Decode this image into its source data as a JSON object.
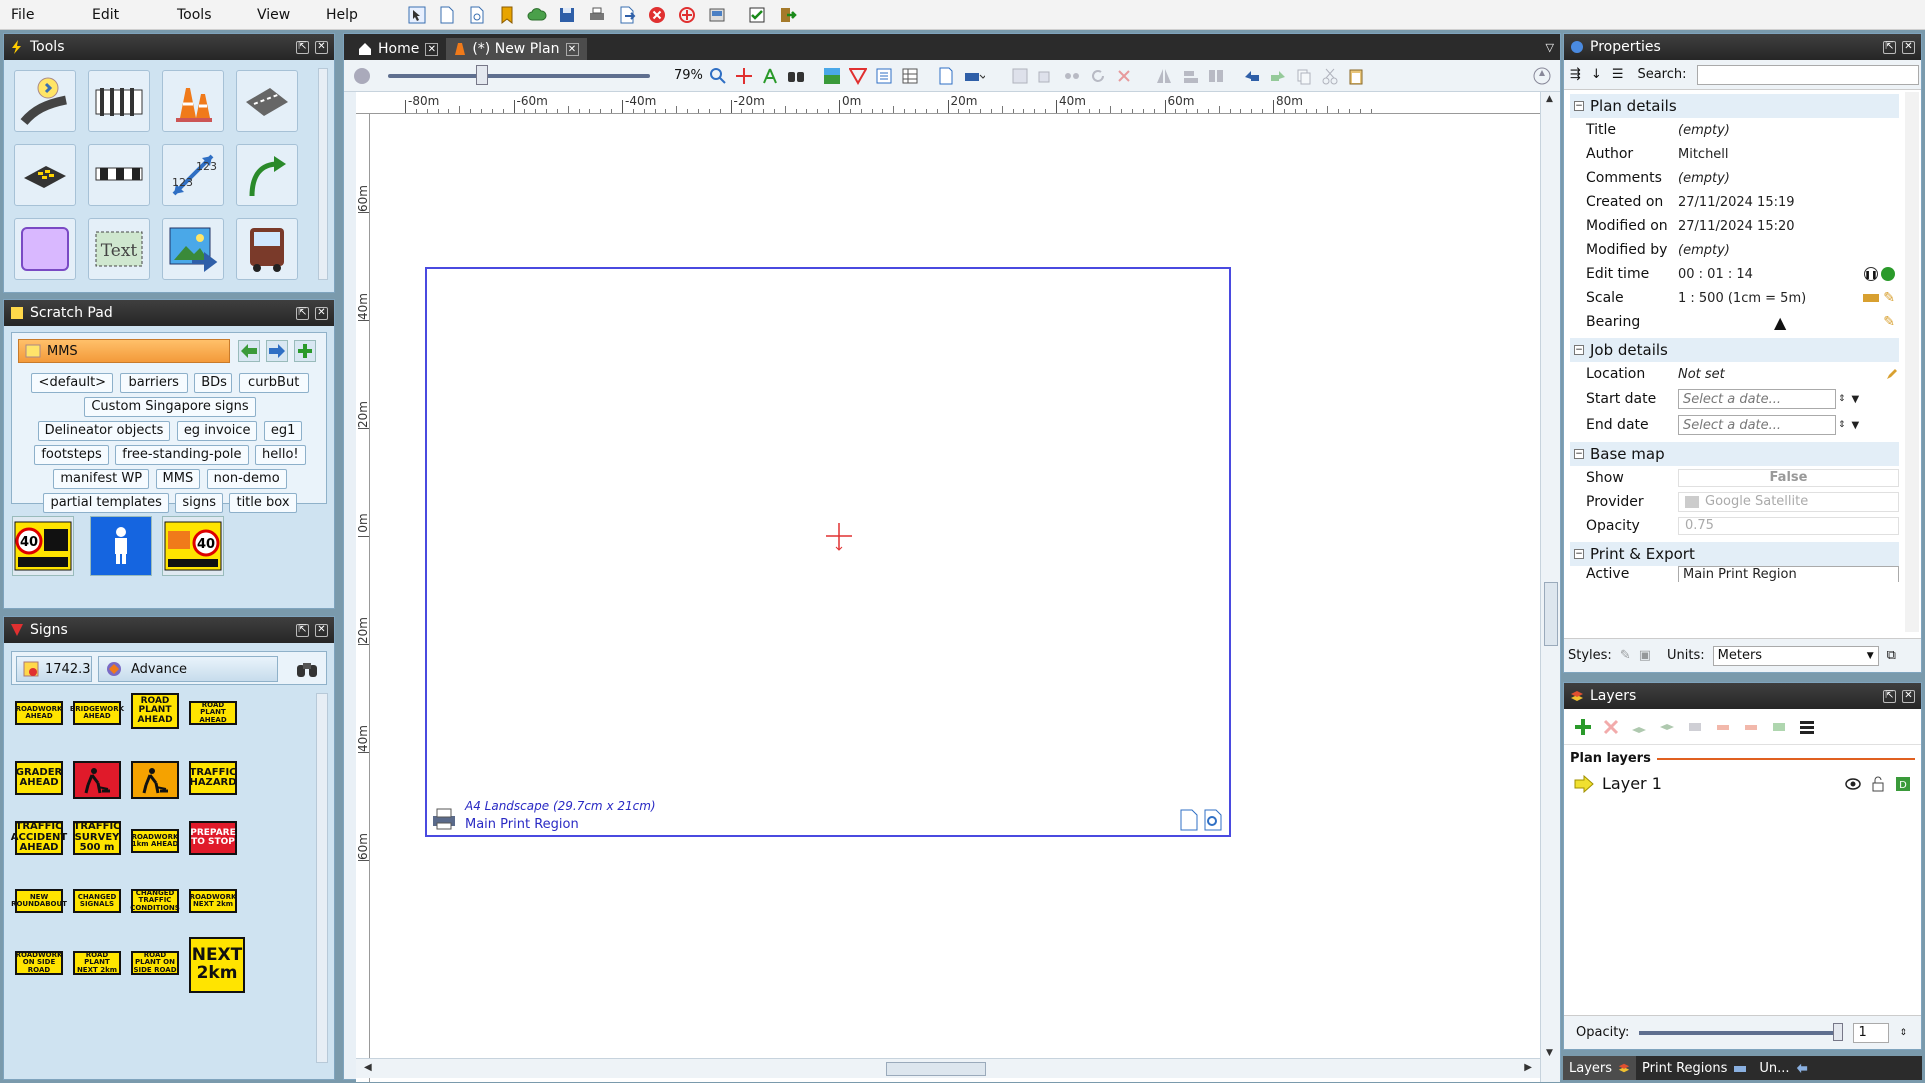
{
  "menu": [
    "File",
    "Edit",
    "Tools",
    "View",
    "Help"
  ],
  "toolbar_icons": [
    "select-icon",
    "new-icon",
    "open-icon",
    "tag-icon",
    "cloud-icon",
    "save-icon",
    "print-icon",
    "export-icon",
    "close-red-icon",
    "target-icon",
    "scanner-icon",
    "check-icon",
    "exit-icon"
  ],
  "tools": {
    "title": "Tools",
    "items": [
      "road-light-tool-icon",
      "barrier-tool-icon",
      "cones-tool-icon",
      "road-segment-tool-icon",
      "keypad-tool-icon",
      "boom-gate-tool-icon",
      "dimension-tool-icon",
      "curved-arrow-tool-icon",
      "shape-tool-icon",
      "text-tool-icon",
      "image-tool-icon",
      "vehicle-tool-icon"
    ],
    "text_tool_label": "Text"
  },
  "scratch": {
    "title": "Scratch Pad",
    "folder": "MMS",
    "chips": [
      "<default>",
      "barriers",
      "BDs",
      "curbBut",
      "Custom Singapore signs",
      "Delineator objects",
      "eg invoice",
      "eg1",
      "footsteps",
      "free-standing-pole",
      "hello!",
      "manifest WP",
      "MMS",
      "non-demo",
      "partial templates",
      "signs",
      "title box"
    ],
    "items": [
      "speed-40-sign",
      "pedestrian-sign",
      "roadwork-40-sign"
    ]
  },
  "signs": {
    "title": "Signs",
    "code": "1742.3",
    "category": "Advance",
    "list": [
      {
        "t": "ROADWORK AHEAD",
        "k": "small"
      },
      {
        "t": "BRIDGEWORK AHEAD",
        "k": "small"
      },
      {
        "t": "ROAD PLANT AHEAD",
        "k": "big"
      },
      {
        "t": "ROAD PLANT AHEAD",
        "k": "small"
      },
      {
        "t": "GRADER AHEAD",
        "k": "mid"
      },
      {
        "t": "",
        "k": "worker-red"
      },
      {
        "t": "",
        "k": "worker-orange"
      },
      {
        "t": "TRAFFIC HAZARD",
        "k": "mid"
      },
      {
        "t": "TRAFFIC ACCIDENT AHEAD",
        "k": "mid"
      },
      {
        "t": "TRAFFIC SURVEY 500 m",
        "k": "mid"
      },
      {
        "t": "ROADWORK 1km AHEAD",
        "k": "small"
      },
      {
        "t": "PREPARE TO STOP",
        "k": "red"
      },
      {
        "t": "NEW ROUNDABOUT",
        "k": "small"
      },
      {
        "t": "CHANGED SIGNALS",
        "k": "small"
      },
      {
        "t": "CHANGED TRAFFIC CONDITIONS",
        "k": "small"
      },
      {
        "t": "ROADWORK NEXT 2km",
        "k": "small"
      },
      {
        "t": "ROADWORK ON SIDE ROAD",
        "k": "small"
      },
      {
        "t": "ROAD PLANT NEXT 2km",
        "k": "small"
      },
      {
        "t": "ROAD PLANT ON SIDE ROAD",
        "k": "small"
      },
      {
        "t": "NEXT 2km",
        "k": "next"
      }
    ]
  },
  "tabs": [
    {
      "label": "Home",
      "icon": "home-icon"
    },
    {
      "label": "(*) New Plan",
      "icon": "cone-icon"
    }
  ],
  "zoom": "79%",
  "ruler_h": [
    "-80m",
    "-60m",
    "-40m",
    "-20m",
    "0m",
    "20m",
    "40m",
    "60m",
    "80m"
  ],
  "ruler_v": [
    "60m",
    "40m",
    "20m",
    "0m",
    "20m",
    "40m",
    "60m"
  ],
  "print_region": {
    "size": "A4 Landscape (29.7cm x 21cm)",
    "name": "Main Print Region"
  },
  "cursor_coords": "182x489",
  "properties": {
    "title": "Properties",
    "search_label": "Search:",
    "sections": {
      "plan": "Plan details",
      "job": "Job details",
      "basemap": "Base map",
      "print": "Print & Export"
    },
    "plan": [
      {
        "k": "Title",
        "v": "(empty)",
        "empty": true
      },
      {
        "k": "Author",
        "v": "Mitchell"
      },
      {
        "k": "Comments",
        "v": "(empty)",
        "empty": true
      },
      {
        "k": "Created on",
        "v": "27/11/2024 15:19"
      },
      {
        "k": "Modified on",
        "v": "27/11/2024 15:20"
      },
      {
        "k": "Modified by",
        "v": "(empty)",
        "empty": true
      },
      {
        "k": "Edit time",
        "v": "00 : 01 : 14"
      },
      {
        "k": "Scale",
        "v": "1 : 500   (1cm = 5m)"
      },
      {
        "k": "Bearing",
        "v": ""
      }
    ],
    "job": {
      "location_label": "Location",
      "location": "Not set",
      "start_label": "Start date",
      "end_label": "End date",
      "date_placeholder": "Select a date..."
    },
    "basemap": {
      "show_label": "Show",
      "show": "False",
      "provider_label": "Provider",
      "provider": "Google Satellite",
      "opacity_label": "Opacity",
      "opacity": "0.75"
    },
    "print": {
      "region_label": "Active region",
      "region": "Main Print Region"
    },
    "styles_label": "Styles:",
    "units_label": "Units:",
    "units": "Meters"
  },
  "layers": {
    "title": "Layers",
    "plan_layers": "Plan layers",
    "layer": "Layer 1",
    "opacity_label": "Opacity:",
    "opacity": "1",
    "opacity_fraction": 1.0
  },
  "bottom_tabs": [
    "Layers",
    "Print Regions",
    "Un..."
  ]
}
